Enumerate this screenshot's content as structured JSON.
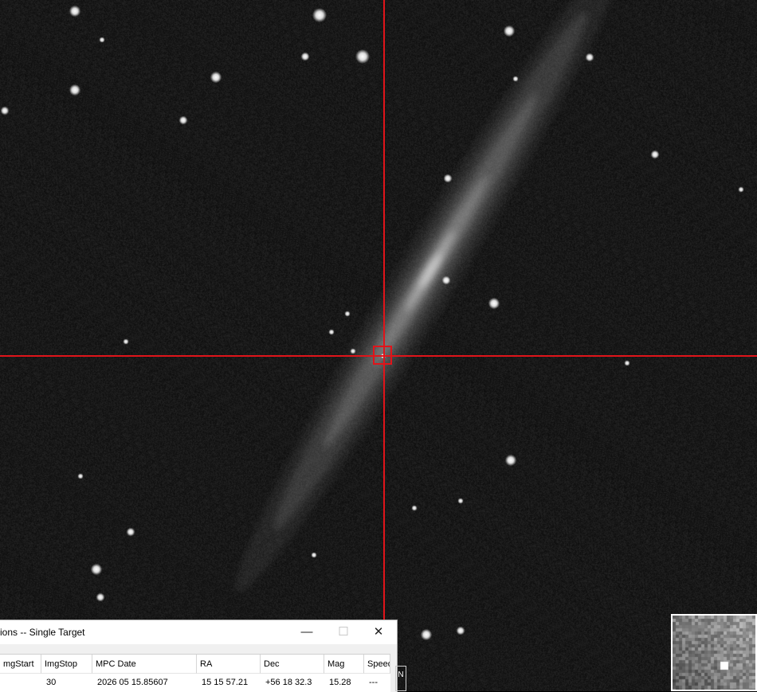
{
  "dialog": {
    "title": "ions -- Single Target",
    "minimize_glyph": "—",
    "maximize_glyph": "☐",
    "close_glyph": "✕",
    "columns": [
      "mgStart",
      "ImgStop",
      "MPC Date",
      "RA",
      "Dec",
      "Mag",
      "Speed"
    ],
    "row": [
      "",
      "30",
      "2026 05 15.85607",
      "15 15 57.21",
      "+56 18 32.3",
      "15.28",
      "---"
    ]
  },
  "compass": {
    "label": "N"
  },
  "crosshair_color": "#e0141a",
  "icons": [
    "minimize-icon",
    "maximize-icon",
    "close-icon"
  ]
}
